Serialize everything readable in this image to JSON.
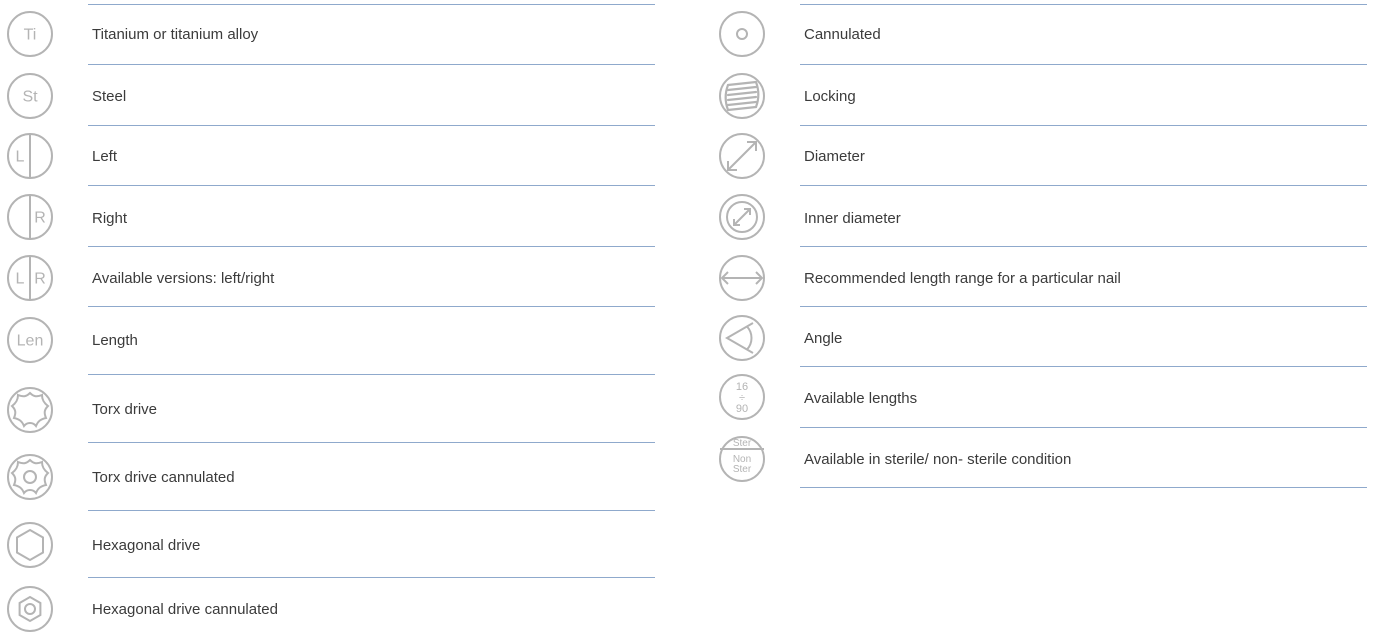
{
  "colors": {
    "rule": "#8fa9cc",
    "icon": "#b4b4b4",
    "text": "#3b3b3b"
  },
  "left_items": [
    {
      "icon": "titanium-icon",
      "glyph": "Ti",
      "label": "Titanium or titanium alloy"
    },
    {
      "icon": "steel-icon",
      "glyph": "St",
      "label": "Steel"
    },
    {
      "icon": "left-icon",
      "glyph": "L",
      "label": "Left"
    },
    {
      "icon": "right-icon",
      "glyph": "R",
      "label": "Right"
    },
    {
      "icon": "left-right-icon",
      "glyph_l": "L",
      "glyph_r": "R",
      "label": "Available versions: left/right"
    },
    {
      "icon": "length-icon",
      "glyph": "Len",
      "label": "Length"
    },
    {
      "icon": "torx-drive-icon",
      "label": "Torx drive"
    },
    {
      "icon": "torx-drive-cannulated-icon",
      "label": "Torx drive cannulated"
    },
    {
      "icon": "hexagonal-drive-icon",
      "label": "Hexagonal drive"
    },
    {
      "icon": "hexagonal-drive-cannulated-icon",
      "label": "Hexagonal drive cannulated"
    }
  ],
  "right_items": [
    {
      "icon": "cannulated-icon",
      "label": "Cannulated"
    },
    {
      "icon": "locking-icon",
      "label": "Locking"
    },
    {
      "icon": "diameter-icon",
      "label": "Diameter"
    },
    {
      "icon": "inner-diameter-icon",
      "label": "Inner diameter"
    },
    {
      "icon": "length-range-icon",
      "label": "Recommended length range for a particular nail"
    },
    {
      "icon": "angle-icon",
      "label": "Angle"
    },
    {
      "icon": "available-lengths-icon",
      "glyph_top": "16",
      "glyph_mid": "÷",
      "glyph_bot": "90",
      "label": "Available lengths"
    },
    {
      "icon": "sterile-icon",
      "glyph_top": "Ster",
      "glyph_mid": "Non",
      "glyph_bot": "Ster",
      "label": "Available in sterile/ non- sterile condition"
    }
  ]
}
